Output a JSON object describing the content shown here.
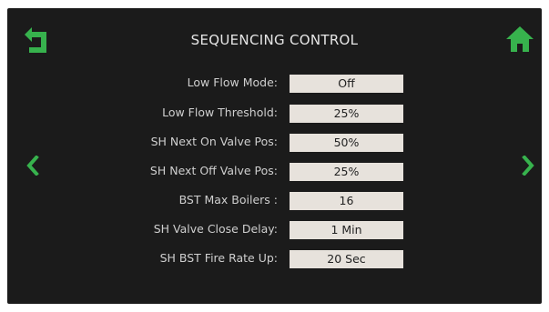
{
  "header": {
    "title": "SEQUENCING CONTROL"
  },
  "icons": {
    "back": "back-arrow-icon",
    "home": "home-icon",
    "prev": "chevron-left-icon",
    "next": "chevron-right-icon"
  },
  "colors": {
    "accent": "#37b24d",
    "background": "#1b1b1b",
    "value_box": "#e7e2dc"
  },
  "settings": [
    {
      "label": "Low Flow Mode:",
      "value": "Off"
    },
    {
      "label": "Low Flow Threshold:",
      "value": "25%"
    },
    {
      "label": "SH Next On Valve Pos:",
      "value": "50%"
    },
    {
      "label": "SH Next Off Valve Pos:",
      "value": "25%"
    },
    {
      "label": "BST Max Boilers :",
      "value": "16"
    },
    {
      "label": "SH Valve Close Delay:",
      "value": "1 Min"
    },
    {
      "label": "SH BST Fire Rate Up:",
      "value": "20 Sec"
    }
  ]
}
